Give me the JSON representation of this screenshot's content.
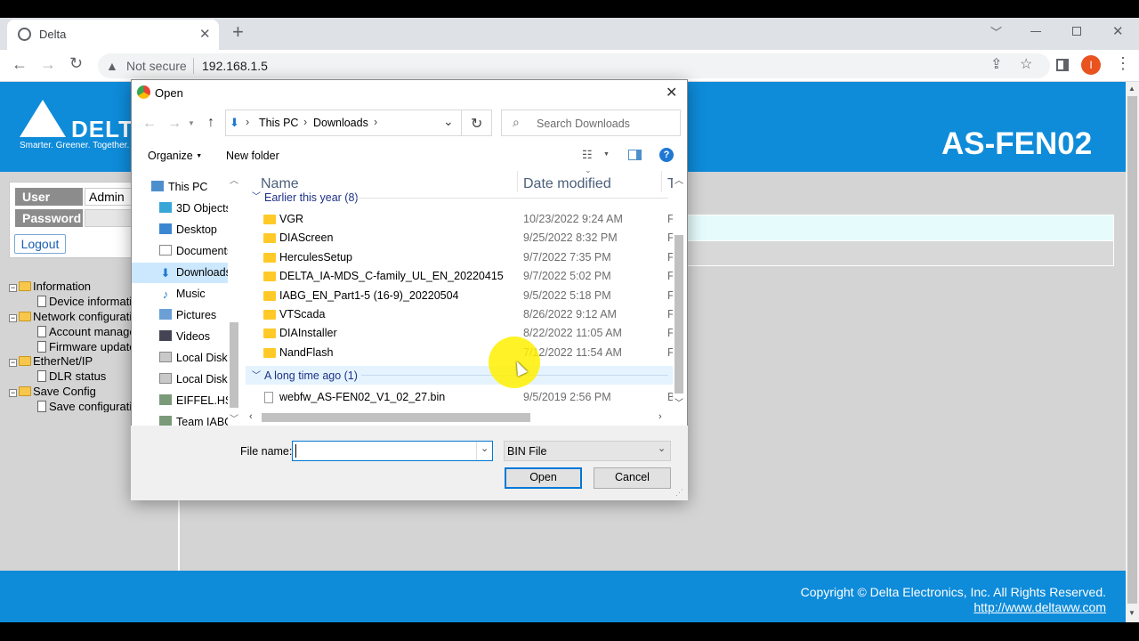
{
  "browser": {
    "tab_title": "Delta",
    "new_tab": "+",
    "security_label": "Not secure",
    "url": "192.168.1.5",
    "profile_initial": "I"
  },
  "page": {
    "brand_logo_text": "DELTA",
    "brand_tagline": "Smarter. Greener. Together.",
    "model": "AS-FEN02",
    "login": {
      "user_label": "User",
      "user_value": "Admin",
      "password_label": "Password",
      "logout_label": "Logout"
    },
    "tree": [
      {
        "label": "Information",
        "kind": "folder"
      },
      {
        "label": "Device information",
        "kind": "doc"
      },
      {
        "label": "Network configuration",
        "kind": "folder"
      },
      {
        "label": "Account management",
        "kind": "doc"
      },
      {
        "label": "Firmware update",
        "kind": "doc"
      },
      {
        "label": "EtherNet/IP",
        "kind": "folder"
      },
      {
        "label": "DLR status",
        "kind": "doc"
      },
      {
        "label": "Save Config",
        "kind": "folder"
      },
      {
        "label": "Save configuration",
        "kind": "doc"
      }
    ],
    "footer": {
      "copyright": "Copyright © Delta Electronics, Inc. All Rights Reserved.",
      "link": "http://www.deltaww.com"
    }
  },
  "dialog": {
    "title": "Open",
    "breadcrumb": [
      "This PC",
      "Downloads"
    ],
    "search_placeholder": "Search Downloads",
    "organize_label": "Organize",
    "new_folder_label": "New folder",
    "nav_items": [
      "This PC",
      "3D Objects",
      "Desktop",
      "Documents",
      "Downloads",
      "Music",
      "Pictures",
      "Videos",
      "Local Disk (C:)",
      "Local Disk (D:)",
      "EIFFEL.HSIE",
      "Team IABG"
    ],
    "columns": {
      "name": "Name",
      "date": "Date modified",
      "type": "Type"
    },
    "groups": [
      {
        "header": "Earlier this year (8)",
        "files": [
          {
            "name": "VGR",
            "date": "10/23/2022 9:24 AM",
            "type": "F"
          },
          {
            "name": "DIAScreen",
            "date": "9/25/2022 8:32 PM",
            "type": "F"
          },
          {
            "name": "HerculesSetup",
            "date": "9/7/2022 7:35 PM",
            "type": "F"
          },
          {
            "name": "DELTA_IA-MDS_C-family_UL_EN_20220415",
            "date": "9/7/2022 5:02 PM",
            "type": "F"
          },
          {
            "name": "IABG_EN_Part1-5 (16-9)_20220504",
            "date": "9/5/2022 5:18 PM",
            "type": "F"
          },
          {
            "name": "VTScada",
            "date": "8/26/2022 9:12 AM",
            "type": "F"
          },
          {
            "name": "DIAInstaller",
            "date": "8/22/2022 11:05 AM",
            "type": "F"
          },
          {
            "name": "NandFlash",
            "date": "7/12/2022 11:54 AM",
            "type": "F"
          }
        ]
      },
      {
        "header": "A long time ago (1)",
        "files": [
          {
            "name": "webfw_AS-FEN02_V1_02_27.bin",
            "date": "9/5/2019 2:56 PM",
            "type": "B"
          }
        ]
      }
    ],
    "file_name_label": "File name:",
    "file_name_value": "",
    "filter_value": "BIN File",
    "open_label": "Open",
    "cancel_label": "Cancel"
  },
  "colors": {
    "banner_blue": "#0e8bd9",
    "page_gray": "#d4d4d4",
    "cursor_highlight": "#fff000",
    "profile_orange": "#e8531f"
  }
}
